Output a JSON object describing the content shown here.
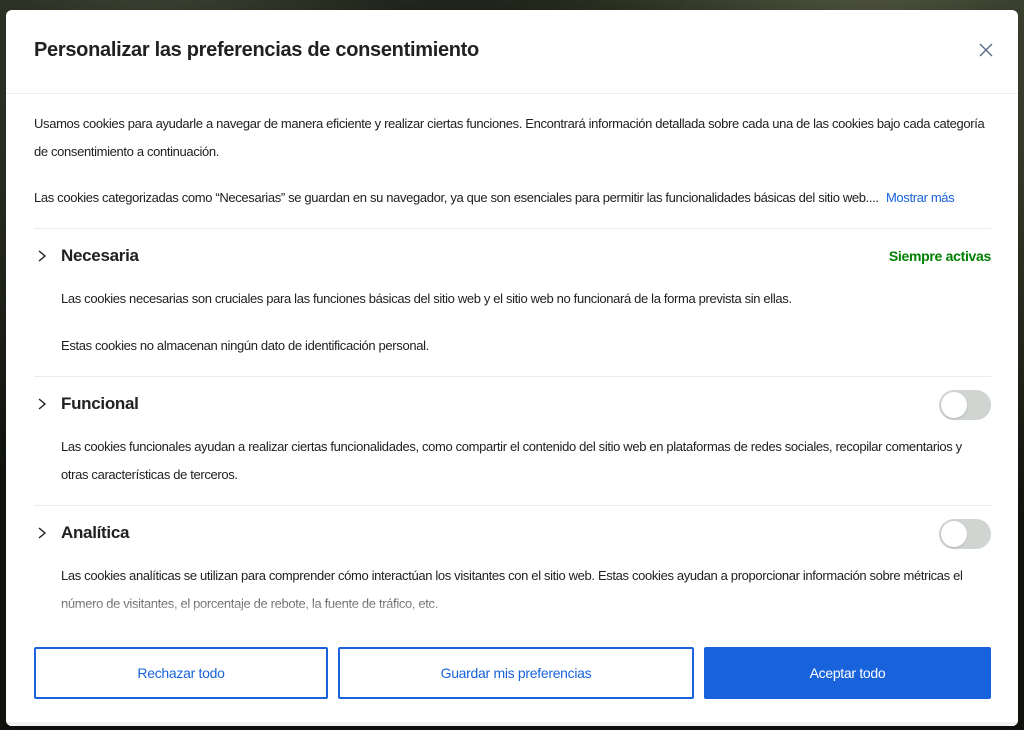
{
  "modal": {
    "title": "Personalizar las preferencias de consentimiento",
    "close_icon": "close-icon"
  },
  "intro": {
    "paragraph1": "Usamos cookies para ayudarle a navegar de manera eficiente y realizar ciertas funciones. Encontrará información detallada sobre cada una de las cookies bajo cada categoría de consentimiento a continuación.",
    "paragraph2": "Las cookies categorizadas como “Necesarias” se guardan en su navegador, ya que son esenciales para permitir las funcionalidades básicas del sitio web.... ",
    "show_more": "Mostrar más"
  },
  "categories": [
    {
      "title": "Necesaria",
      "status": "Siempre activas",
      "descriptions": [
        "Las cookies necesarias son cruciales para las funciones básicas del sitio web y el sitio web no funcionará de la forma prevista sin ellas.",
        "Estas cookies no almacenan ningún dato de identificación personal."
      ]
    },
    {
      "title": "Funcional",
      "toggle_on": false,
      "descriptions": [
        "Las cookies funcionales ayudan a realizar ciertas funcionalidades, como compartir el contenido del sitio web en plataformas de redes sociales, recopilar comentarios y otras características de terceros."
      ]
    },
    {
      "title": "Analítica",
      "toggle_on": false,
      "descriptions": [
        "Las cookies analíticas se utilizan para comprender cómo interactúan los visitantes con el sitio web. Estas cookies ayudan a proporcionar información sobre métricas el número de visitantes, el porcentaje de rebote, la fuente de tráfico, etc."
      ]
    }
  ],
  "footer": {
    "reject_label": "Rechazar todo",
    "save_label": "Guardar mis preferencias",
    "accept_label": "Aceptar todo"
  },
  "colors": {
    "accent": "#1863dc",
    "always_active": "#008000",
    "toggle_off": "#d0d5d2"
  }
}
